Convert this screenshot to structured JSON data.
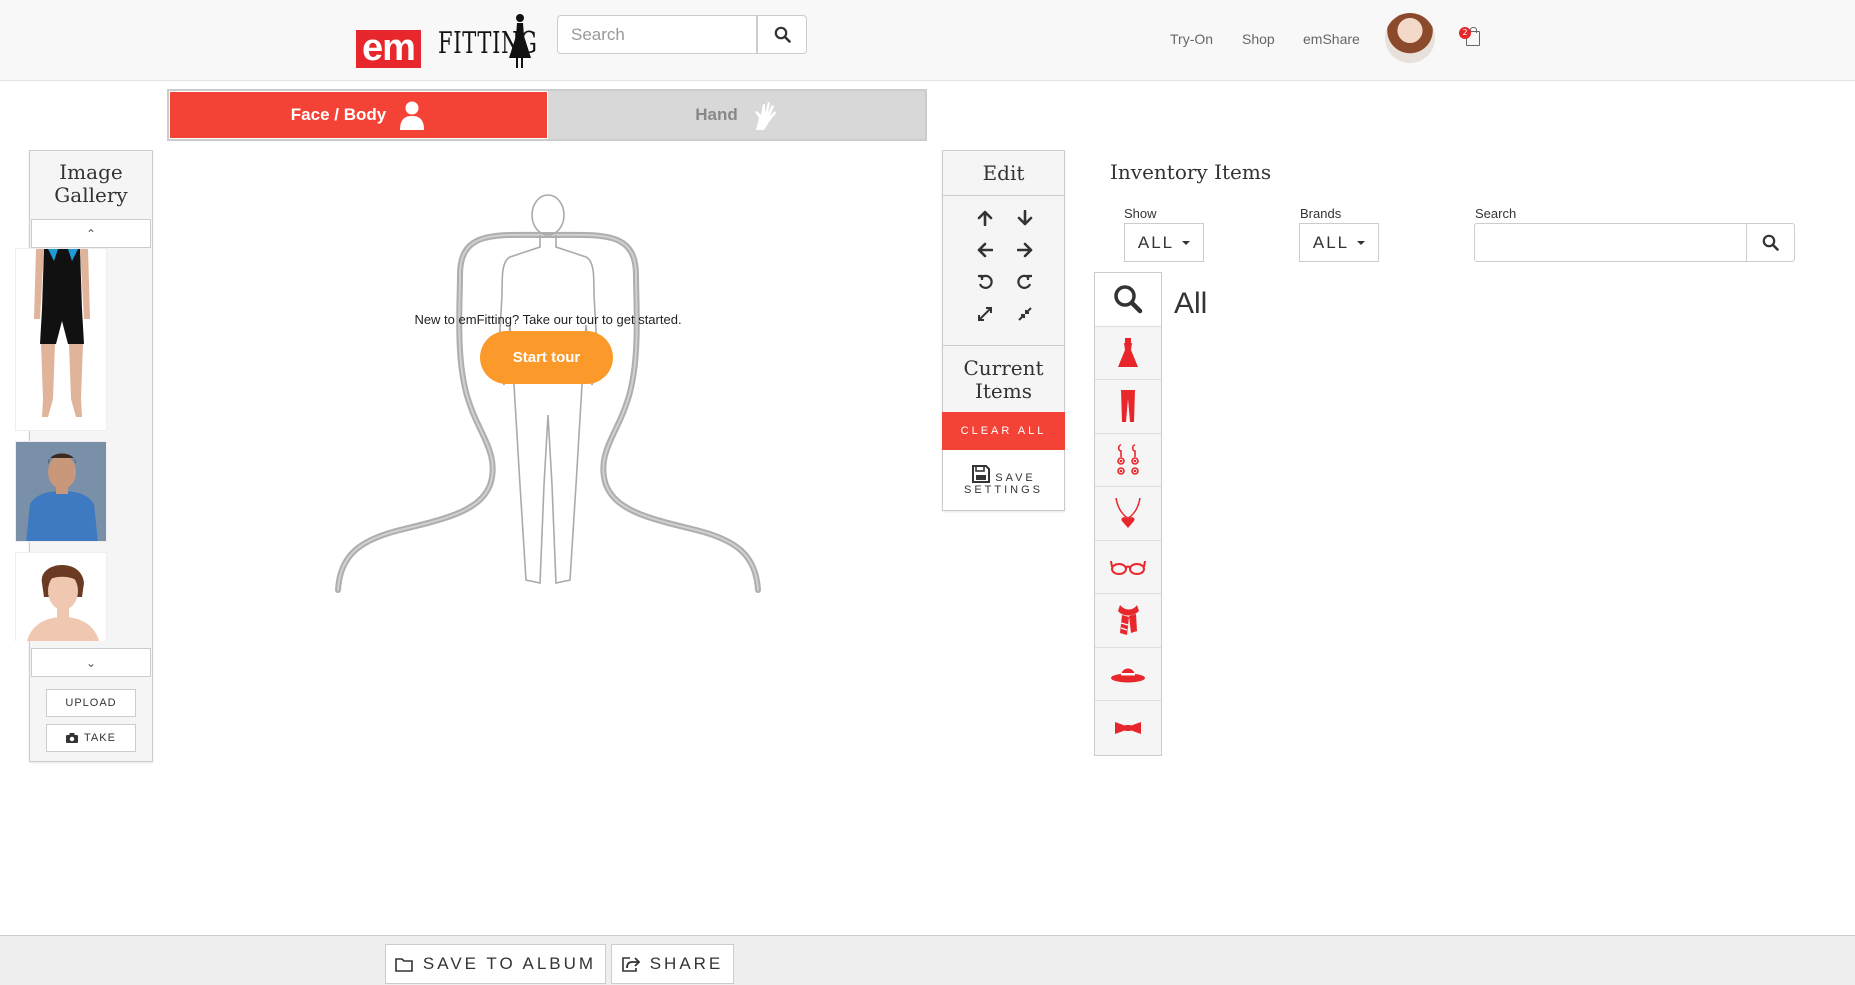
{
  "header": {
    "logo": {
      "em": "em",
      "fitting": "FITTING"
    },
    "search": {
      "placeholder": "Search"
    },
    "nav": {
      "try_on": "Try-On",
      "shop": "Shop",
      "emshare": "emShare"
    },
    "cart_count": "2"
  },
  "mode_tabs": [
    {
      "label": "Face / Body",
      "icon": "person-icon",
      "active": true
    },
    {
      "label": "Hand",
      "icon": "hand-icon",
      "active": false
    }
  ],
  "gallery": {
    "title": "Image Gallery",
    "up_arrow": "⌃",
    "down_arrow": "⌄",
    "thumbnails": [
      {
        "alt": "swimsuit-model"
      },
      {
        "alt": "blue-shirt-man"
      },
      {
        "alt": "short-hair-woman"
      }
    ],
    "upload_label": "UPLOAD",
    "take_label": "TAKE"
  },
  "canvas": {
    "tour_text": "New to emFitting? Take our tour to get started.",
    "tour_button": "Start tour"
  },
  "edit_panel": {
    "title": "Edit",
    "controls": [
      "arrow-up-icon",
      "arrow-down-icon",
      "arrow-left-icon",
      "arrow-right-icon",
      "rotate-left-icon",
      "rotate-right-icon",
      "expand-icon",
      "compress-icon"
    ],
    "current_items_title": "Current Items",
    "clear_all": "CLEAR ALL",
    "save_settings_line1": "SAVE",
    "save_settings_line2": "SETTINGS"
  },
  "inventory": {
    "title": "Inventory Items",
    "show_label": "Show",
    "show_value": "ALL",
    "brands_label": "Brands",
    "brands_value": "ALL",
    "search_label": "Search",
    "search_value": "",
    "category_heading": "All",
    "categories": [
      "search-icon",
      "dress-icon",
      "pants-icon",
      "earrings-icon",
      "necklace-icon",
      "glasses-icon",
      "scarf-icon",
      "hat-icon",
      "bowtie-icon"
    ]
  },
  "footer": {
    "save_to_album": "SAVE TO ALBUM",
    "share": "SHARE"
  },
  "colors": {
    "accent_red": "#f44336",
    "tour_orange": "#fb9a2a",
    "icon_red": "#e8272c"
  }
}
